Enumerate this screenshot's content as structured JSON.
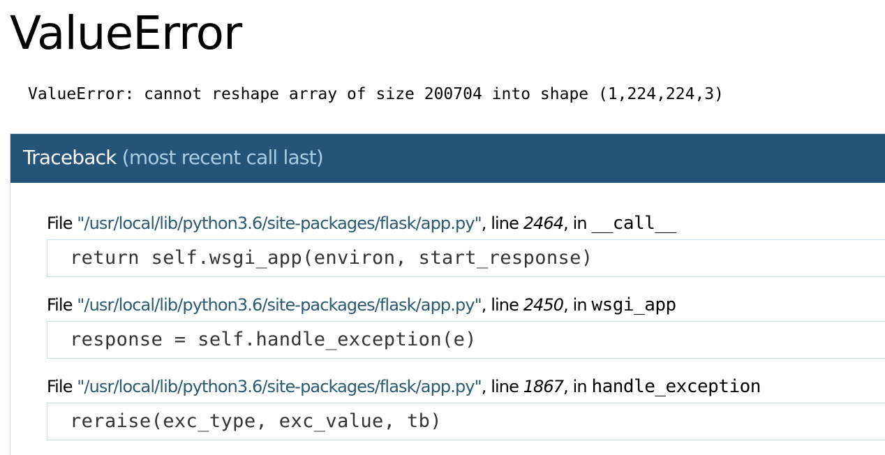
{
  "page": {
    "title": "ValueError",
    "error_message": "ValueError: cannot reshape array of size 200704 into shape (1,224,224,3)"
  },
  "traceback": {
    "title": "Traceback",
    "subtitle": "(most recent call last)",
    "frames": [
      {
        "file_prefix": "File ",
        "filename": "\"/usr/local/lib/python3.6/site-packages/flask/app.py\"",
        "line_prefix": ", line ",
        "lineno": "2464",
        "in_prefix": ", in ",
        "funcname": "__call__",
        "code": "return self.wsgi_app(environ, start_response)"
      },
      {
        "file_prefix": "File ",
        "filename": "\"/usr/local/lib/python3.6/site-packages/flask/app.py\"",
        "line_prefix": ", line ",
        "lineno": "2450",
        "in_prefix": ", in ",
        "funcname": "wsgi_app",
        "code": "response = self.handle_exception(e)"
      },
      {
        "file_prefix": "File ",
        "filename": "\"/usr/local/lib/python3.6/site-packages/flask/app.py\"",
        "line_prefix": ", line ",
        "lineno": "1867",
        "in_prefix": ", in ",
        "funcname": "handle_exception",
        "code": "reraise(exc_type, exc_value, tb)"
      }
    ]
  },
  "colors": {
    "header_bg": "#255479",
    "header_subtitle": "#a9cde2",
    "filename": "#2a5a73",
    "code_border": "#cfe1e8"
  }
}
